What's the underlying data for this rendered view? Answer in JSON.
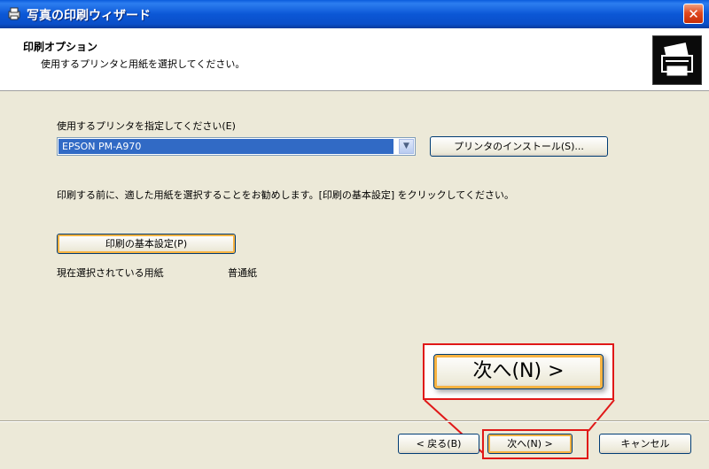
{
  "window": {
    "title": "写真の印刷ウィザード",
    "close_glyph": "✕"
  },
  "header": {
    "title": "印刷オプション",
    "subtitle": "使用するプリンタと用紙を選択してください。"
  },
  "printer": {
    "label": "使用するプリンタを指定してください(E)",
    "selected": "EPSON PM-A970",
    "dropdown_glyph": "▼",
    "install_button": "プリンタのインストール(S)..."
  },
  "advice": "印刷する前に、適した用紙を選択することをお勧めします。[印刷の基本設定] をクリックしてください。",
  "preferences_button": "印刷の基本設定(P)",
  "paper": {
    "label": "現在選択されている用紙",
    "value": "普通紙"
  },
  "zoom_callout": {
    "label": "次へ(N) >"
  },
  "footer": {
    "back_button": "< 戻る(B)",
    "next_button": "次へ(N) >",
    "cancel_button": "キャンセル"
  },
  "colors": {
    "highlight": "#e01818",
    "selection": "#316ac5",
    "titlebar": "#0a5bdc"
  }
}
